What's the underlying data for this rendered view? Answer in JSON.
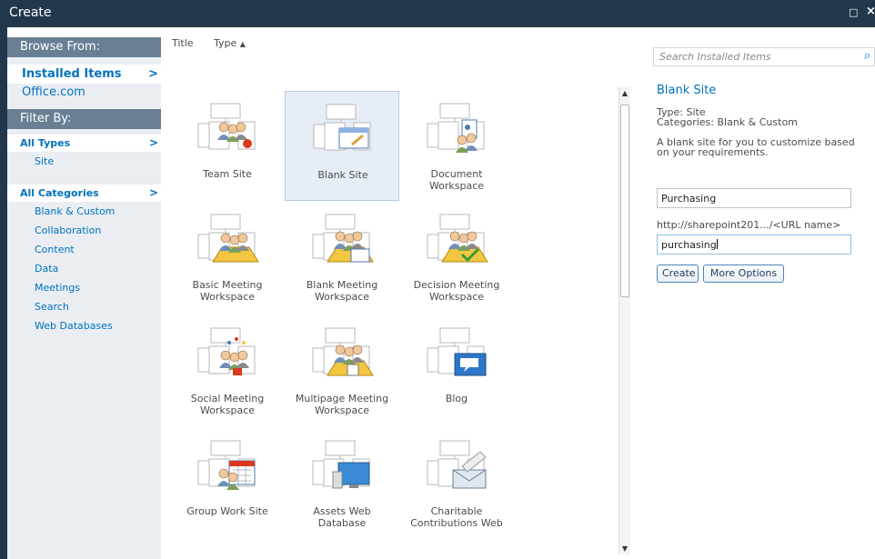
{
  "dialog": {
    "title": "Create",
    "max_glyph": "□",
    "close_glyph": "×"
  },
  "sidebar": {
    "browse_heading": "Browse From:",
    "browse_selected": "Installed Items",
    "browse_other": "Office.com",
    "filter_heading": "Filter By:",
    "types_selected": "All Types",
    "types": [
      "Site"
    ],
    "categories_selected": "All Categories",
    "categories": [
      "Blank & Custom",
      "Collaboration",
      "Content",
      "Data",
      "Meetings",
      "Search",
      "Web Databases"
    ],
    "chevron": ">"
  },
  "sort": {
    "title": "Title",
    "type": "Type",
    "type_arrow": "▲"
  },
  "templates": [
    "Team Site",
    "Blank Site",
    "Document Workspace",
    "Basic Meeting Workspace",
    "Blank Meeting Workspace",
    "Decision Meeting Workspace",
    "Social Meeting Workspace",
    "Multipage Meeting Workspace",
    "Blog",
    "Group Work Site",
    "Assets Web Database",
    "Charitable Contributions Web"
  ],
  "templates_lines": [
    [
      "Team Site"
    ],
    [
      "Blank Site"
    ],
    [
      "Document",
      "Workspace"
    ],
    [
      "Basic Meeting",
      "Workspace"
    ],
    [
      "Blank Meeting",
      "Workspace"
    ],
    [
      "Decision Meeting",
      "Workspace"
    ],
    [
      "Social Meeting",
      "Workspace"
    ],
    [
      "Multipage Meeting",
      "Workspace"
    ],
    [
      "Blog"
    ],
    [
      "Group Work Site"
    ],
    [
      "Assets Web",
      "Database"
    ],
    [
      "Charitable",
      "Contributions Web"
    ]
  ],
  "selected_template": "Blank Site",
  "details": {
    "search_placeholder": "Search Installed Items",
    "title": "Blank Site",
    "type_line": "Type: Site",
    "categories_line": "Categories: Blank & Custom",
    "description_1": "A blank site for you to customize based",
    "description_2": "on your requirements.",
    "title_value": "Purchasing",
    "url_prefix": "http://sharepoint201.../<URL name>",
    "url_value": "purchasing",
    "create_label": "Create",
    "more_options_label": "More Options"
  },
  "colors": {
    "accent": "#0072bc",
    "titlebar": "#21374c",
    "sidebar_bg": "#eaeef3",
    "heading_bg": "#6a7f94"
  }
}
